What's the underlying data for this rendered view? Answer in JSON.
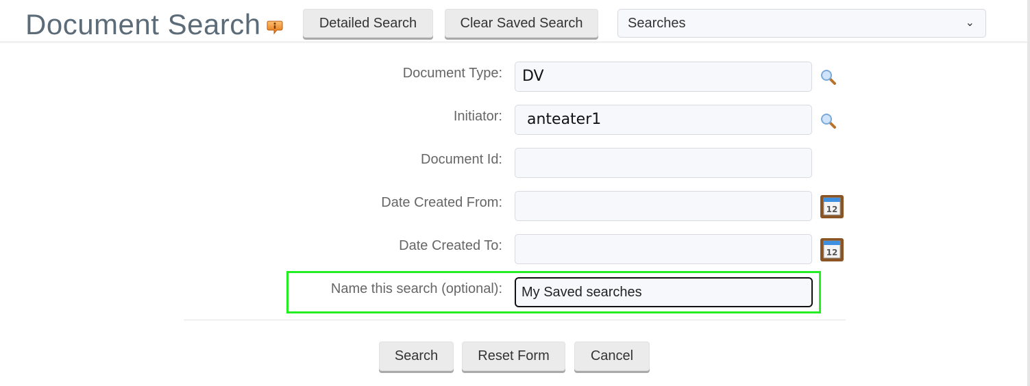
{
  "header": {
    "title": "Document Search",
    "info_icon": "info-speech-bubble-icon",
    "buttons": {
      "detailed_search": "Detailed Search",
      "clear_saved_search": "Clear Saved Search"
    },
    "searches_select": {
      "selected": "Searches"
    }
  },
  "form": {
    "fields": [
      {
        "label": "Document Type:",
        "value": "DV",
        "icon": "lookup-magnifier-icon"
      },
      {
        "label": "Initiator:",
        "value": " anteater1",
        "icon": "lookup-magnifier-icon"
      },
      {
        "label": "Document Id:",
        "value": ""
      },
      {
        "label": "Date Created From:",
        "value": "",
        "icon": "calendar-icon"
      },
      {
        "label": "Date Created To:",
        "value": "",
        "icon": "calendar-icon"
      }
    ],
    "save_name": {
      "label": "Name this search (optional):",
      "value": "My Saved searches"
    },
    "highlight_color": "#22ee22"
  },
  "actions": {
    "search": "Search",
    "reset": "Reset Form",
    "cancel": "Cancel"
  }
}
